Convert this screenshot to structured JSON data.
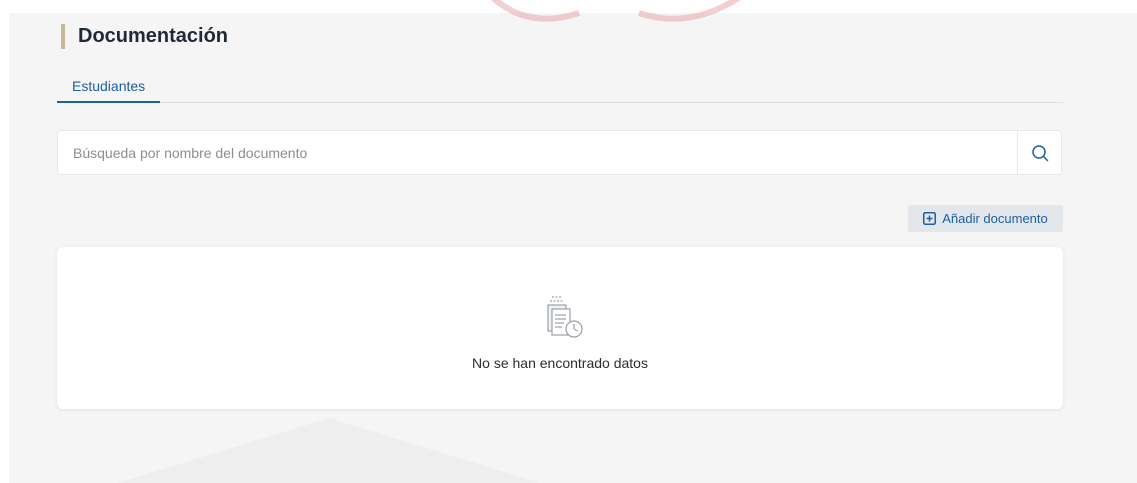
{
  "header": {
    "title": "Documentación"
  },
  "tabs": [
    {
      "label": "Estudiantes",
      "active": true
    }
  ],
  "search": {
    "placeholder": "Búsqueda por nombre del documento",
    "value": "",
    "icon": "search-icon"
  },
  "toolbar": {
    "add_label": "Añadir documento",
    "add_icon": "plus-square-icon"
  },
  "empty_state": {
    "message": "No se han encontrado datos",
    "icon": "documents-clock-icon"
  },
  "colors": {
    "accent": "#1d5fa0",
    "title_bar": "#c9b79c",
    "background": "#f5f5f6",
    "watermark": "#e8a0a0"
  }
}
